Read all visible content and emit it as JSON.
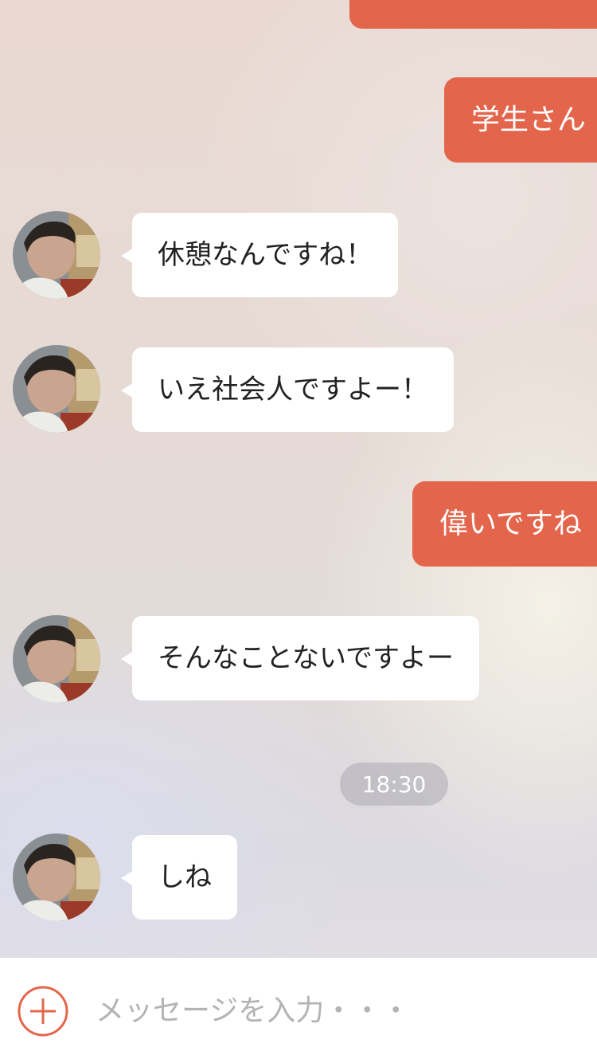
{
  "messages": [
    {
      "side": "out",
      "text": ""
    },
    {
      "side": "out",
      "text": "学生さん"
    },
    {
      "side": "in",
      "text": "休憩なんですね！"
    },
    {
      "side": "in",
      "text": "いえ社会人ですよー！"
    },
    {
      "side": "out",
      "text": "偉いですね"
    },
    {
      "side": "in",
      "text": "そんなことないですよー"
    },
    {
      "side": "in",
      "text": "しね"
    }
  ],
  "timestamp": "18:30",
  "composer": {
    "placeholder": "メッセージを入力・・・",
    "add_icon": "plus-circle-icon"
  },
  "colors": {
    "outgoing_bubble": "#e3664c",
    "incoming_bubble": "#ffffff",
    "accent": "#e3664c"
  }
}
